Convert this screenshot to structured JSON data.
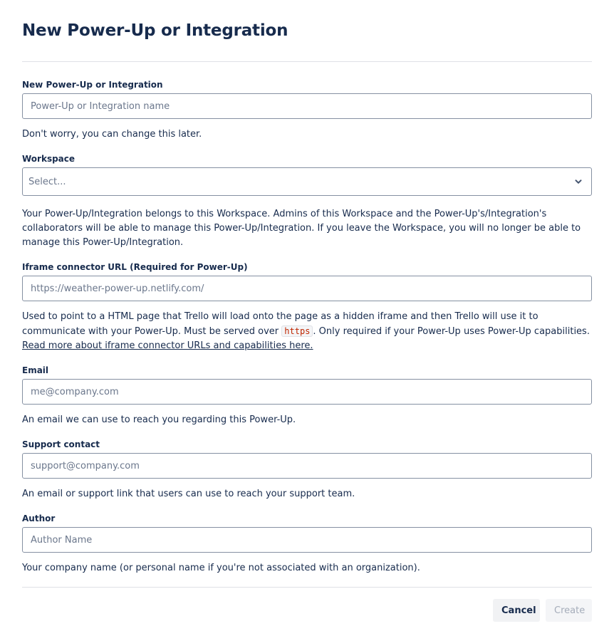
{
  "dialog": {
    "title": "New Power-Up or Integration",
    "name_field": {
      "label": "New Power-Up or Integration",
      "placeholder": "Power-Up or Integration name",
      "value": "",
      "help": "Don't worry, you can change this later."
    },
    "workspace_field": {
      "label": "Workspace",
      "selected": "Select...",
      "help": "Your Power-Up/Integration belongs to this Workspace. Admins of this Workspace and the Power-Up's/Integration's collaborators will be able to manage this Power-Up/Integration. If you leave the Workspace, you will no longer be able to manage this Power-Up/Integration."
    },
    "iframe_field": {
      "label": "Iframe connector URL (Required for Power-Up)",
      "placeholder": "https://weather-power-up.netlify.com/",
      "value": "",
      "help_before": "Used to point to a HTML page that Trello will load onto the page as a hidden iframe and then Trello will use it to communicate with your Power-Up. Must be served over ",
      "help_code": "https",
      "help_after": ". Only required if your Power-Up uses Power-Up capabilities. ",
      "help_link": "Read more about iframe connector URLs and capabilities here."
    },
    "email_field": {
      "label": "Email",
      "placeholder": "me@company.com",
      "value": "",
      "help": "An email we can use to reach you regarding this Power-Up."
    },
    "support_field": {
      "label": "Support contact",
      "placeholder": "support@company.com",
      "value": "",
      "help": "An email or support link that users can use to reach your support team."
    },
    "author_field": {
      "label": "Author",
      "placeholder": "Author Name",
      "value": "",
      "help": "Your company name (or personal name if you're not associated with an organization)."
    },
    "actions": {
      "cancel_label": "Cancel",
      "create_label": "Create"
    }
  },
  "icons": {
    "select_indicator": "chevron-down-icon"
  },
  "colors": {
    "text": "#172b4d",
    "border": "#8590a2",
    "code_text": "#bf2600",
    "disabled_text": "#a5adba"
  }
}
